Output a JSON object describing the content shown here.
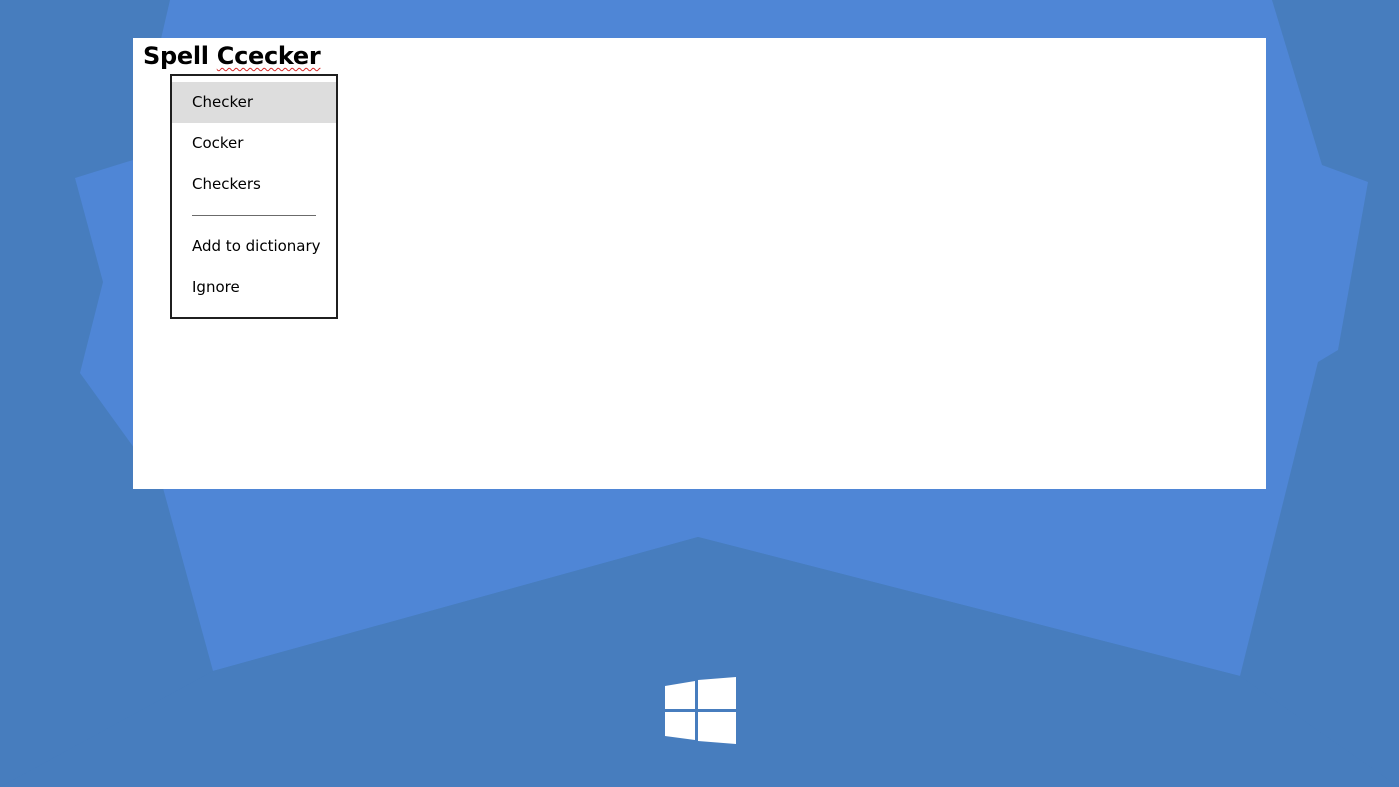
{
  "document": {
    "word_correct": "Spell",
    "word_misspelled": "Ccecker"
  },
  "context_menu": {
    "suggestions": [
      "Checker",
      "Cocker",
      "Checkers"
    ],
    "add_to_dictionary_label": "Add to dictionary",
    "ignore_label": "Ignore"
  },
  "icons": {
    "logo": "windows-logo-icon"
  },
  "colors": {
    "background": "#477dbe",
    "background_light": "#4f86d6",
    "highlight": "#dddddd",
    "spell_error_underline": "#d42828"
  }
}
